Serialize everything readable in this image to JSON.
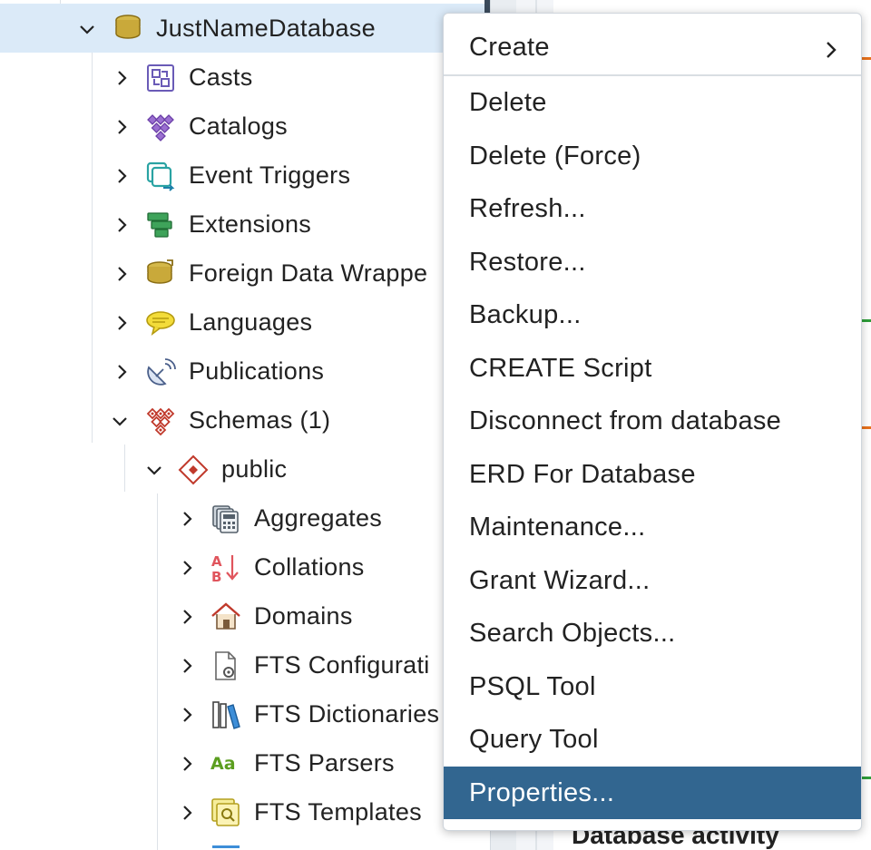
{
  "tree": {
    "database": {
      "label": "JustNameDatabase",
      "icon": "database-icon"
    },
    "children": [
      {
        "label": "Casts",
        "icon": "casts-icon"
      },
      {
        "label": "Catalogs",
        "icon": "catalogs-icon"
      },
      {
        "label": "Event Triggers",
        "icon": "event-triggers-icon"
      },
      {
        "label": "Extensions",
        "icon": "extensions-icon"
      },
      {
        "label": "Foreign Data Wrappe",
        "icon": "foreign-data-wrappers-icon"
      },
      {
        "label": "Languages",
        "icon": "languages-icon"
      },
      {
        "label": "Publications",
        "icon": "publications-icon"
      },
      {
        "label": "Schemas (1)",
        "icon": "schemas-icon"
      }
    ],
    "schema": {
      "label": "public",
      "icon": "schema-icon"
    },
    "schema_children": [
      {
        "label": "Aggregates",
        "icon": "aggregates-icon"
      },
      {
        "label": "Collations",
        "icon": "collations-icon"
      },
      {
        "label": "Domains",
        "icon": "domains-icon"
      },
      {
        "label": "FTS Configurati",
        "icon": "fts-configurations-icon"
      },
      {
        "label": "FTS Dictionaries",
        "icon": "fts-dictionaries-icon"
      },
      {
        "label": "FTS Parsers",
        "icon": "fts-parsers-icon"
      },
      {
        "label": "FTS Templates",
        "icon": "fts-templates-icon"
      }
    ]
  },
  "context_menu": {
    "items": [
      {
        "label": "Create",
        "submenu": true
      },
      {
        "label": "Delete"
      },
      {
        "label": "Delete (Force)"
      },
      {
        "label": "Refresh..."
      },
      {
        "label": "Restore..."
      },
      {
        "label": "Backup..."
      },
      {
        "label": "CREATE Script"
      },
      {
        "label": "Disconnect from database"
      },
      {
        "label": "ERD For Database"
      },
      {
        "label": "Maintenance..."
      },
      {
        "label": "Grant Wizard..."
      },
      {
        "label": "Search Objects..."
      },
      {
        "label": "PSQL Tool"
      },
      {
        "label": "Query Tool"
      },
      {
        "label": "Properties...",
        "highlighted": true
      }
    ]
  },
  "dashboard": {
    "section_title": "Database activity"
  },
  "colors": {
    "selected_row": "#dbeaf8",
    "menu_highlight": "#326690",
    "accent_orange": "#e8711c",
    "accent_green": "#2e9e3a"
  }
}
